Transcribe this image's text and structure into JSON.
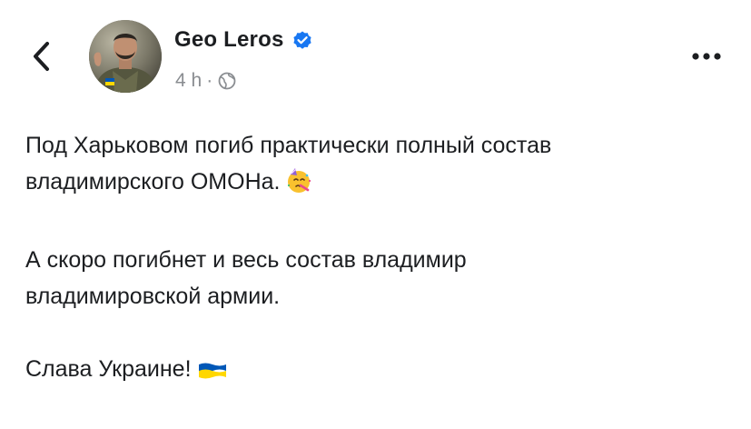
{
  "post": {
    "author": {
      "name": "Geo Leros",
      "verified": true,
      "avatar_alt": "avatar"
    },
    "meta": {
      "time": "4 h",
      "separator": "·",
      "audience_icon": "globe-icon"
    },
    "header_icons": {
      "back": "chevron-left-icon",
      "more": "more-dots-icon",
      "verified": "verified-badge-icon"
    },
    "paragraphs": [
      {
        "lines": [
          "Под Харьковом погиб практически полный состав",
          "владимирского ОМОНа."
        ],
        "emoji": "partying-face-emoji"
      },
      {
        "lines": [
          "А скоро погибнет и весь состав владимир",
          "владимировской армии."
        ]
      },
      {
        "lines": [
          "Слава Украине!"
        ],
        "emoji": "ukraine-flag-emoji"
      }
    ]
  },
  "colors": {
    "text": "#1c1e21",
    "secondary_text": "#8a8d91",
    "verified_blue": "#1877f2",
    "flag_blue": "#0057b7",
    "flag_yellow": "#ffd700"
  }
}
